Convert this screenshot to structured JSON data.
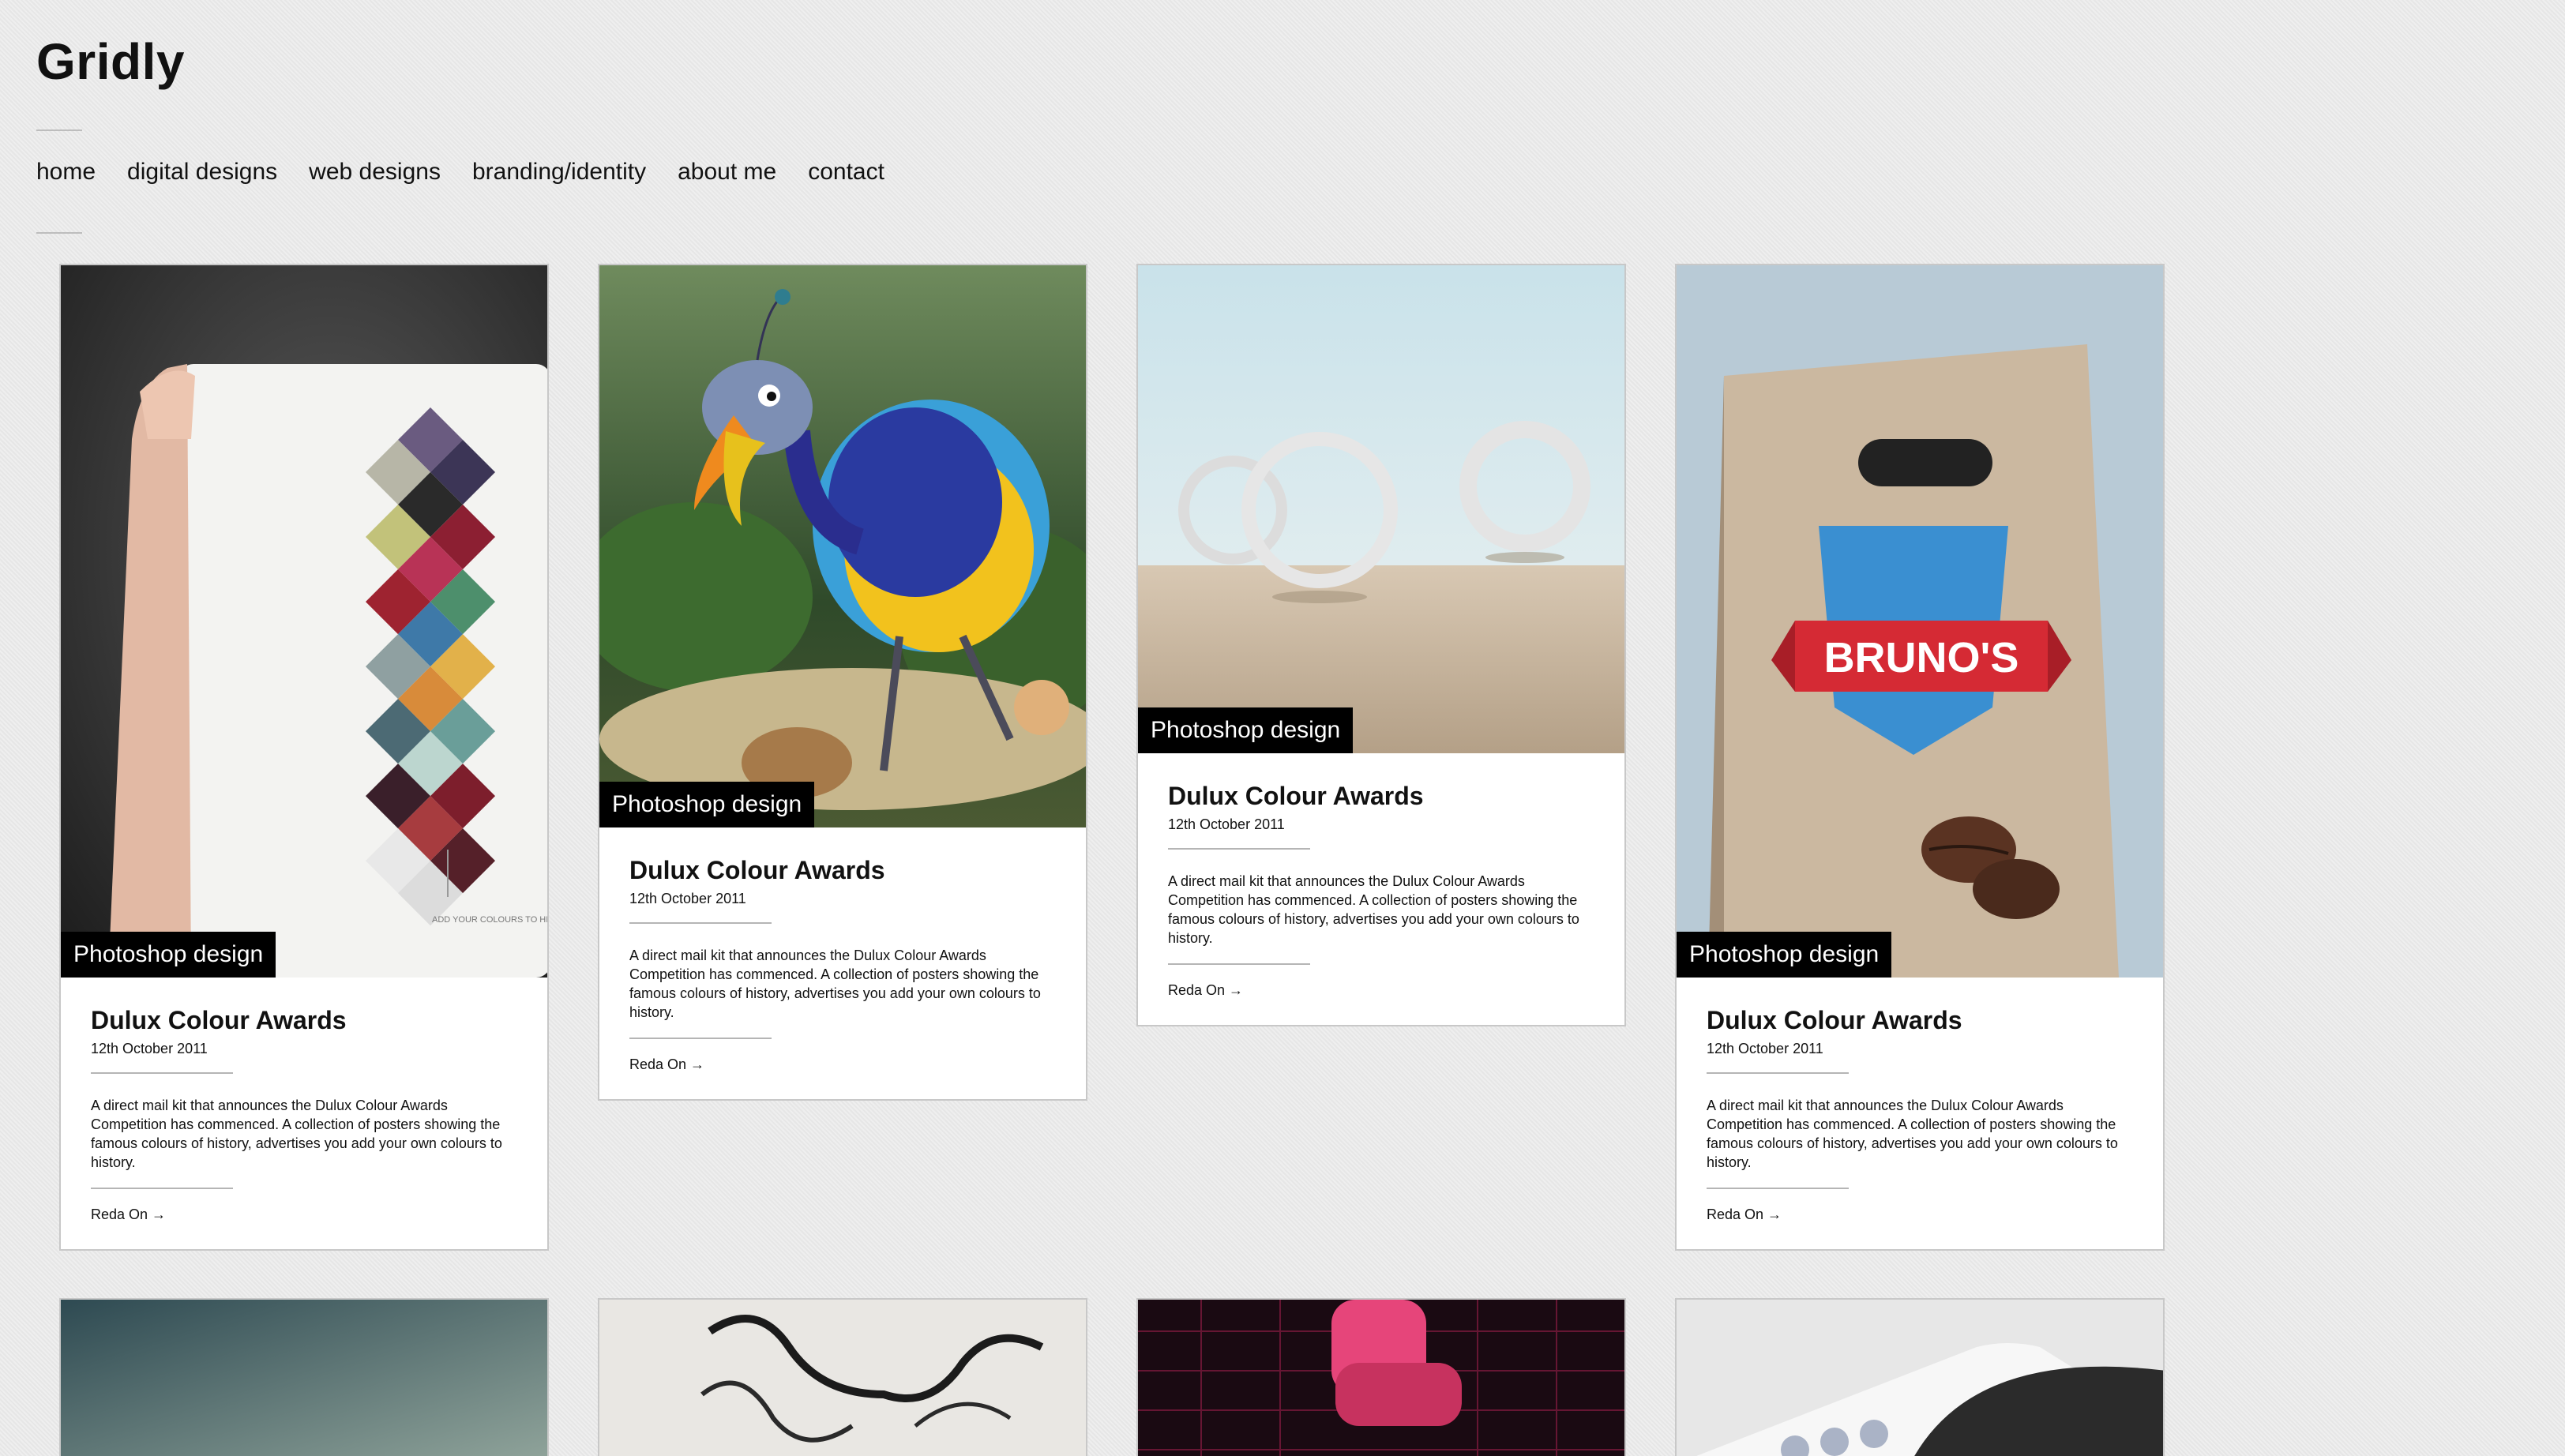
{
  "site": {
    "logo": "Gridly"
  },
  "nav": [
    "home",
    "digital designs",
    "web designs",
    "branding/identity",
    "about me",
    "contact"
  ],
  "cards": [
    {
      "tag": "Photoshop design",
      "title": "Dulux Colour Awards",
      "date": "12th October 2011",
      "description": "A direct mail kit that announces the Dulux Colour Awards Competition has commenced. A collection of posters showing the famous colours of history, advertises you add your own colours to history.",
      "read_more": "Reda On →",
      "image_text": "ADD YOUR COLOURS TO HISTORY"
    },
    {
      "tag": "Photoshop design",
      "title": "Dulux Colour Awards",
      "date": "12th October 2011",
      "description": "A direct mail kit that announces the Dulux Colour Awards Competition has commenced. A collection of posters showing the famous colours of history, advertises you add your own colours to history.",
      "read_more": "Reda On →"
    },
    {
      "tag": "Photoshop design",
      "title": "Dulux Colour Awards",
      "date": "12th October 2011",
      "description": "A direct mail kit that announces the Dulux Colour Awards Competition has commenced. A collection of posters showing the famous colours of history, advertises you add your own colours to history.",
      "read_more": "Reda On →"
    },
    {
      "tag": "Photoshop design",
      "title": "Dulux Colour Awards",
      "date": "12th October 2011",
      "description": "A direct mail kit that announces the Dulux Colour Awards Competition has commenced. A collection of posters showing the famous colours of history, advertises you add your own colours to history.",
      "read_more": "Reda On →",
      "image_text": "BRUNO'S"
    }
  ]
}
